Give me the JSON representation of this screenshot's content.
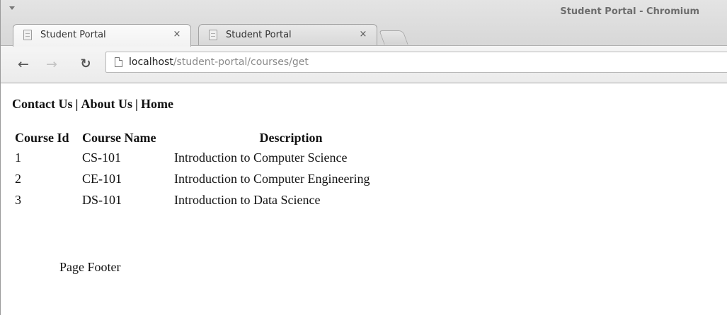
{
  "window": {
    "title": "Student Portal - Chromium"
  },
  "tabs": [
    {
      "label": "Student Portal",
      "close": "×"
    },
    {
      "label": "Student Portal",
      "close": "×"
    }
  ],
  "toolbar": {
    "back_glyph": "🡐",
    "forward_glyph": "🡒",
    "reload_glyph": "C"
  },
  "address_bar": {
    "host": "localhost",
    "path": "/student-portal/courses/get"
  },
  "nav_links": [
    {
      "label": "Contact Us"
    },
    {
      "label": "About Us"
    },
    {
      "label": "Home"
    }
  ],
  "nav_separator": "|",
  "courses_table": {
    "headers": [
      "Course Id",
      "Course Name",
      "Description"
    ],
    "rows": [
      {
        "id": "1",
        "name": "CS-101",
        "description": "Introduction to Computer Science"
      },
      {
        "id": "2",
        "name": "CE-101",
        "description": "Introduction to Computer Engineering"
      },
      {
        "id": "3",
        "name": "DS-101",
        "description": "Introduction to Data Science"
      }
    ]
  },
  "footer": {
    "text": "Page Footer"
  }
}
